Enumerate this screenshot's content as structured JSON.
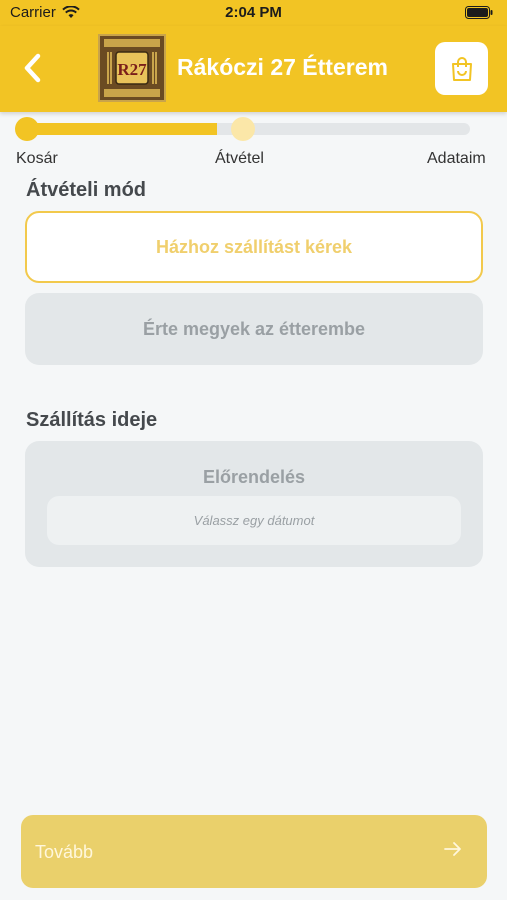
{
  "status_bar": {
    "carrier": "Carrier",
    "time": "2:04 PM"
  },
  "header": {
    "title": "Rákóczi 27 Étterem",
    "logo_text": "R27"
  },
  "progress": {
    "current_step": 2,
    "fill_fraction": 0.43,
    "steps": [
      {
        "label": "Kosár",
        "state": "done"
      },
      {
        "label": "Átvétel",
        "state": "current"
      },
      {
        "label": "Adataim",
        "state": "pending"
      }
    ]
  },
  "pickup": {
    "title": "Átvételi mód",
    "options": [
      {
        "label": "Házhoz szállítást kérek",
        "selected": true
      },
      {
        "label": "Érte megyek az étterembe",
        "selected": false
      }
    ]
  },
  "delivery_time": {
    "title": "Szállítás ideje",
    "card_title": "Előrendelés",
    "date_placeholder": "Válassz egy dátumot"
  },
  "footer": {
    "next_label": "Tovább"
  },
  "colors": {
    "accent": "#f2c424",
    "button": "#ead06b",
    "muted": "#e3e7e9"
  }
}
